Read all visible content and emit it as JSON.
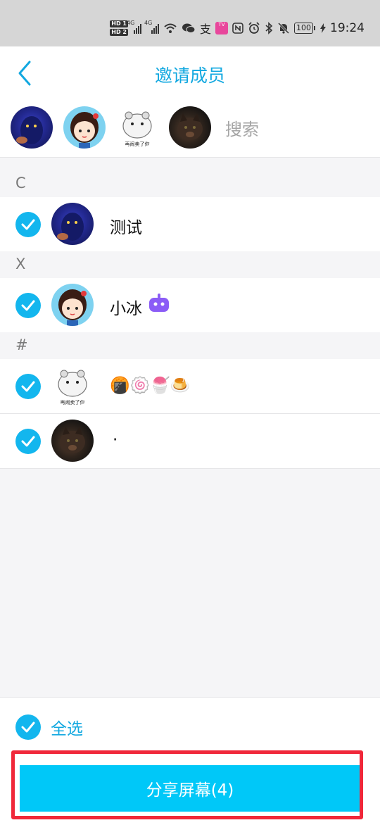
{
  "status_bar": {
    "hd1": "HD 1",
    "hd2": "HD 2",
    "net1": "4G",
    "net2": "4G",
    "battery": "100",
    "time": "19:24",
    "icons": [
      "wifi-icon",
      "wechat-icon",
      "alipay-icon",
      "tv-app-icon",
      "nfc-icon",
      "alarm-icon",
      "bluetooth-icon",
      "mute-icon",
      "battery-icon",
      "charging-icon"
    ]
  },
  "header": {
    "title": "邀请成员",
    "back_icon": "chevron-left-icon"
  },
  "selected_strip": {
    "avatars": [
      "night-character",
      "cartoon-girl",
      "hamster",
      "cat"
    ],
    "search_placeholder": "搜索"
  },
  "sections": [
    {
      "letter": "C",
      "members": [
        {
          "name": "测试",
          "avatar": "night-character",
          "checked": true
        }
      ]
    },
    {
      "letter": "X",
      "members": [
        {
          "name": "小冰",
          "avatar": "cartoon-girl",
          "checked": true,
          "badge": "robot-icon"
        }
      ]
    },
    {
      "letter": "#",
      "members": [
        {
          "name": "🍘🍥🍧🍮",
          "avatar": "hamster",
          "checked": true,
          "avatar_caption": "再闹卖了你"
        },
        {
          "name": "·",
          "avatar": "cat",
          "checked": true
        }
      ]
    }
  ],
  "bottom": {
    "select_all_label": "全选",
    "share_button_label": "分享屏幕(4)"
  },
  "colors": {
    "accent": "#12a8e0",
    "check": "#13b6ee",
    "button": "#00c8f8",
    "highlight": "#f0283a"
  }
}
